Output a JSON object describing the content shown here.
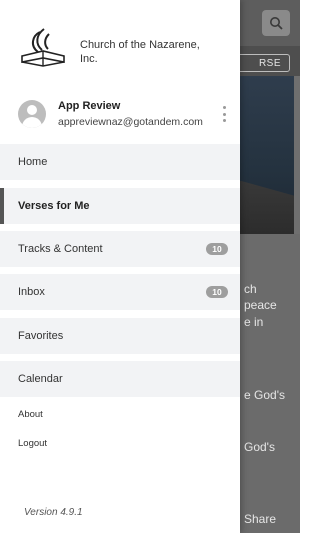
{
  "background": {
    "tab_pill_label": "RSE",
    "text_lines": [
      "ch",
      "peace",
      "e in",
      "e God's",
      "God's"
    ],
    "share_label": "Share"
  },
  "drawer": {
    "org_name": "Church of the Nazarene, Inc.",
    "account": {
      "name": "App Review",
      "email": "appreviewnaz@gotandem.com"
    },
    "menu": [
      {
        "label": "Home",
        "badge": ""
      },
      {
        "label": "Verses for Me",
        "badge": "",
        "active": true
      },
      {
        "label": "Tracks & Content",
        "badge": "10"
      },
      {
        "label": "Inbox",
        "badge": "10"
      },
      {
        "label": "Favorites",
        "badge": ""
      },
      {
        "label": "Calendar",
        "badge": ""
      }
    ],
    "links": [
      "About",
      "Logout"
    ],
    "version": "Version 4.9.1"
  },
  "icons": {
    "search": "search-icon",
    "logo": "church-logo-icon",
    "avatar": "avatar-icon",
    "more": "kebab-menu-icon"
  }
}
